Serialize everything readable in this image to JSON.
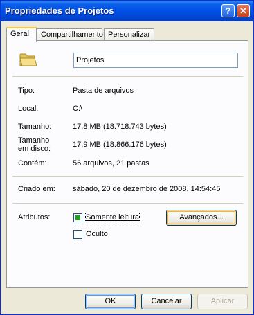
{
  "window": {
    "title": "Propriedades de Projetos",
    "help_label": "?",
    "close_label": "✕"
  },
  "tabs": [
    {
      "label": "Geral",
      "active": true
    },
    {
      "label": "Compartilhamento",
      "active": false
    },
    {
      "label": "Personalizar",
      "active": false
    }
  ],
  "general": {
    "folder_icon": "folder-icon",
    "name_value": "Projetos",
    "rows": [
      {
        "label": "Tipo:",
        "value": "Pasta de arquivos"
      },
      {
        "label": "Local:",
        "value": "C:\\"
      },
      {
        "label": "Tamanho:",
        "value": "17,8 MB (18.718.743 bytes)"
      },
      {
        "label_line1": "Tamanho",
        "label_line2": "em disco:",
        "value": "17,9 MB (18.866.176 bytes)"
      },
      {
        "label": "Contém:",
        "value": "56 arquivos, 21 pastas"
      }
    ],
    "created_label": "Criado em:",
    "created_value": "sábado, 20 de dezembro de 2008, 14:54:45",
    "attributes_label": "Atributos:",
    "readonly_label": "Somente leitura",
    "readonly_checked": true,
    "hidden_label": "Oculto",
    "hidden_checked": false,
    "advanced_label": "Avançados..."
  },
  "footer": {
    "ok_label": "OK",
    "cancel_label": "Cancelar",
    "apply_label": "Aplicar"
  },
  "colors": {
    "titlebar": "#0050e6",
    "dialog_bg": "#ece9d8",
    "panel_bg": "#fcfcfe",
    "active_tab_accent": "#ffc83c"
  }
}
